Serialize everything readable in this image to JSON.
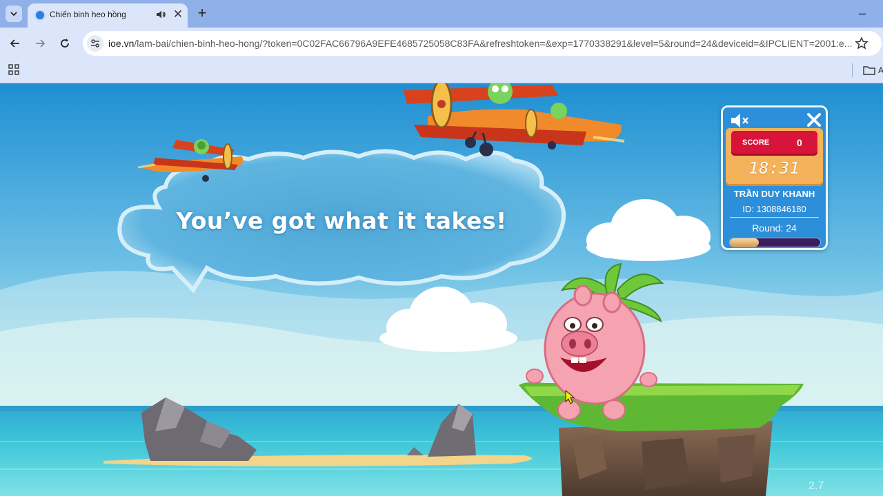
{
  "browser": {
    "tab": {
      "title": "Chiến binh heo hồng"
    },
    "url": {
      "host": "ioe.vn",
      "path": "/lam-bai/chien-binh-heo-hong/?token=0C02FAC66796A9EFE4685725058C83FA&refreshtoken=&exp=1770338291&level=5&round=24&deviceid=&IPCLIENT=2001:e..."
    },
    "bookmarks": {
      "folder_label": "A"
    }
  },
  "game": {
    "message": "You’ve got what it takes!",
    "version": "2.7",
    "hud": {
      "score_label": "SCORE",
      "score_value": "0",
      "timer": "18:31",
      "player_name": "TRẦN DUY KHANH",
      "player_id": "ID: 1308846180",
      "round": "Round: 24",
      "progress_fraction": 0.32
    }
  },
  "colors": {
    "sky_top": "#1f8fd2",
    "sky_bottom": "#d7f1ef",
    "sea": "#3ec6d8",
    "hud_blue": "#2d8fd9",
    "score_red": "#d8143a",
    "board_orange": "#f4b25a"
  }
}
